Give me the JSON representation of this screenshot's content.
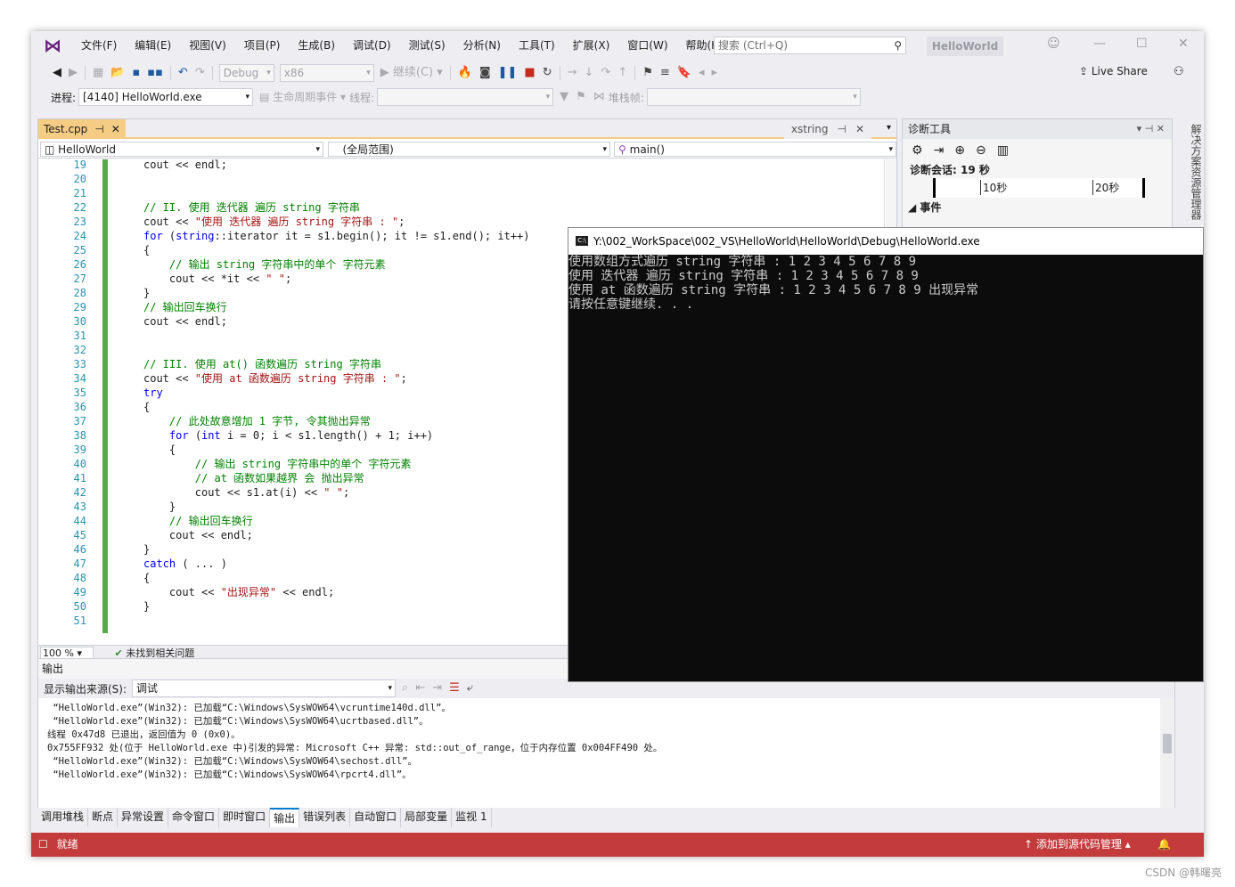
{
  "menubar": {
    "items": [
      "文件(F)",
      "编辑(E)",
      "视图(V)",
      "项目(P)",
      "生成(B)",
      "调试(D)",
      "测试(S)",
      "分析(N)",
      "工具(T)",
      "扩展(X)",
      "窗口(W)",
      "帮助(H)"
    ],
    "search_placeholder": "搜索 (Ctrl+Q)",
    "solution_name": "HelloWorld"
  },
  "toolbar": {
    "config": "Debug",
    "platform": "x86",
    "continue": "继续(C)",
    "live_share": "Live Share"
  },
  "debugbar": {
    "process_label": "进程:",
    "process_value": "[4140] HelloWorld.exe",
    "lifecycle": "生命周期事件",
    "thread_label": "线程:",
    "stackframe_label": "堆栈帧:"
  },
  "editor": {
    "active_tab": "Test.cpp",
    "right_tab": "xstring",
    "nav_project": "HelloWorld",
    "nav_scope": "(全局范围)",
    "nav_function": "main()",
    "zoom": "100 %",
    "status": "未找到相关问题",
    "lines": [
      {
        "n": "19",
        "t": "cout << endl;"
      },
      {
        "n": "20",
        "t": ""
      },
      {
        "n": "21",
        "t": ""
      },
      {
        "n": "22",
        "t": "// II. 使用 迭代器 遍历 string 字符串"
      },
      {
        "n": "23",
        "t": "cout << \"使用 迭代器 遍历 string 字符串 : \";"
      },
      {
        "n": "24",
        "t": "for (string::iterator it = s1.begin(); it != s1.end(); it++)"
      },
      {
        "n": "25",
        "t": "{"
      },
      {
        "n": "26",
        "t": "    // 输出 string 字符串中的单个 字符元素"
      },
      {
        "n": "27",
        "t": "    cout << *it << \" \";"
      },
      {
        "n": "28",
        "t": "}"
      },
      {
        "n": "29",
        "t": "// 输出回车换行"
      },
      {
        "n": "30",
        "t": "cout << endl;"
      },
      {
        "n": "31",
        "t": ""
      },
      {
        "n": "32",
        "t": ""
      },
      {
        "n": "33",
        "t": "// III. 使用 at() 函数遍历 string 字符串"
      },
      {
        "n": "34",
        "t": "cout << \"使用 at 函数遍历 string 字符串 : \";"
      },
      {
        "n": "35",
        "t": "try"
      },
      {
        "n": "36",
        "t": "{"
      },
      {
        "n": "37",
        "t": "    // 此处故意增加 1 字节, 令其抛出异常"
      },
      {
        "n": "38",
        "t": "    for (int i = 0; i < s1.length() + 1; i++)"
      },
      {
        "n": "39",
        "t": "    {"
      },
      {
        "n": "40",
        "t": "        // 输出 string 字符串中的单个 字符元素"
      },
      {
        "n": "41",
        "t": "        // at 函数如果越界 会 抛出异常"
      },
      {
        "n": "42",
        "t": "        cout << s1.at(i) << \" \";"
      },
      {
        "n": "43",
        "t": "    }"
      },
      {
        "n": "44",
        "t": "    // 输出回车换行"
      },
      {
        "n": "45",
        "t": "    cout << endl;"
      },
      {
        "n": "46",
        "t": "}"
      },
      {
        "n": "47",
        "t": "catch ( ... )"
      },
      {
        "n": "48",
        "t": "{"
      },
      {
        "n": "49",
        "t": "    cout << \"出现异常\" << endl;"
      },
      {
        "n": "50",
        "t": "}"
      },
      {
        "n": "51",
        "t": ""
      }
    ]
  },
  "diagnostics": {
    "title": "诊断工具",
    "session": "诊断会话: 19 秒",
    "tick1": "10秒",
    "tick2": "20秒",
    "events": "事件"
  },
  "side_panel": "解决方案资源管理器",
  "console": {
    "title": "Y:\\002_WorkSpace\\002_VS\\HelloWorld\\HelloWorld\\Debug\\HelloWorld.exe",
    "lines": [
      "使用数组方式遍历 string 字符串 : 1 2 3 4 5 6 7 8 9",
      "使用 迭代器 遍历 string 字符串 : 1 2 3 4 5 6 7 8 9",
      "使用 at 函数遍历 string 字符串 : 1 2 3 4 5 6 7 8 9 出现异常",
      "请按任意键继续. . ."
    ]
  },
  "output": {
    "title": "输出",
    "source_label": "显示输出来源(S):",
    "source_value": "调试",
    "lines": [
      " “HelloWorld.exe”(Win32): 已加载“C:\\Windows\\SysWOW64\\vcruntime140d.dll”。",
      " “HelloWorld.exe”(Win32): 已加载“C:\\Windows\\SysWOW64\\ucrtbased.dll”。",
      "线程 0x47d8 已退出，返回值为 0 (0x0)。",
      "0x755FF932 处(位于 HelloWorld.exe 中)引发的异常: Microsoft C++ 异常: std::out_of_range，位于内存位置 0x004FF490 处。",
      " “HelloWorld.exe”(Win32): 已加载“C:\\Windows\\SysWOW64\\sechost.dll”。",
      " “HelloWorld.exe”(Win32): 已加载“C:\\Windows\\SysWOW64\\rpcrt4.dll”。"
    ]
  },
  "bottom_tabs": [
    "调用堆栈",
    "断点",
    "异常设置",
    "命令窗口",
    "即时窗口",
    "输出",
    "错误列表",
    "自动窗口",
    "局部变量",
    "监视 1"
  ],
  "statusbar": {
    "ready": "就绪",
    "source_control": "添加到源代码管理"
  },
  "watermark": "CSDN @韩曙亮",
  "colors": {
    "status_bg": "#c43b3b",
    "tab_active": "#f5cc84",
    "comment": "#008000",
    "keyword": "#0000ff",
    "string": "#a31515"
  }
}
